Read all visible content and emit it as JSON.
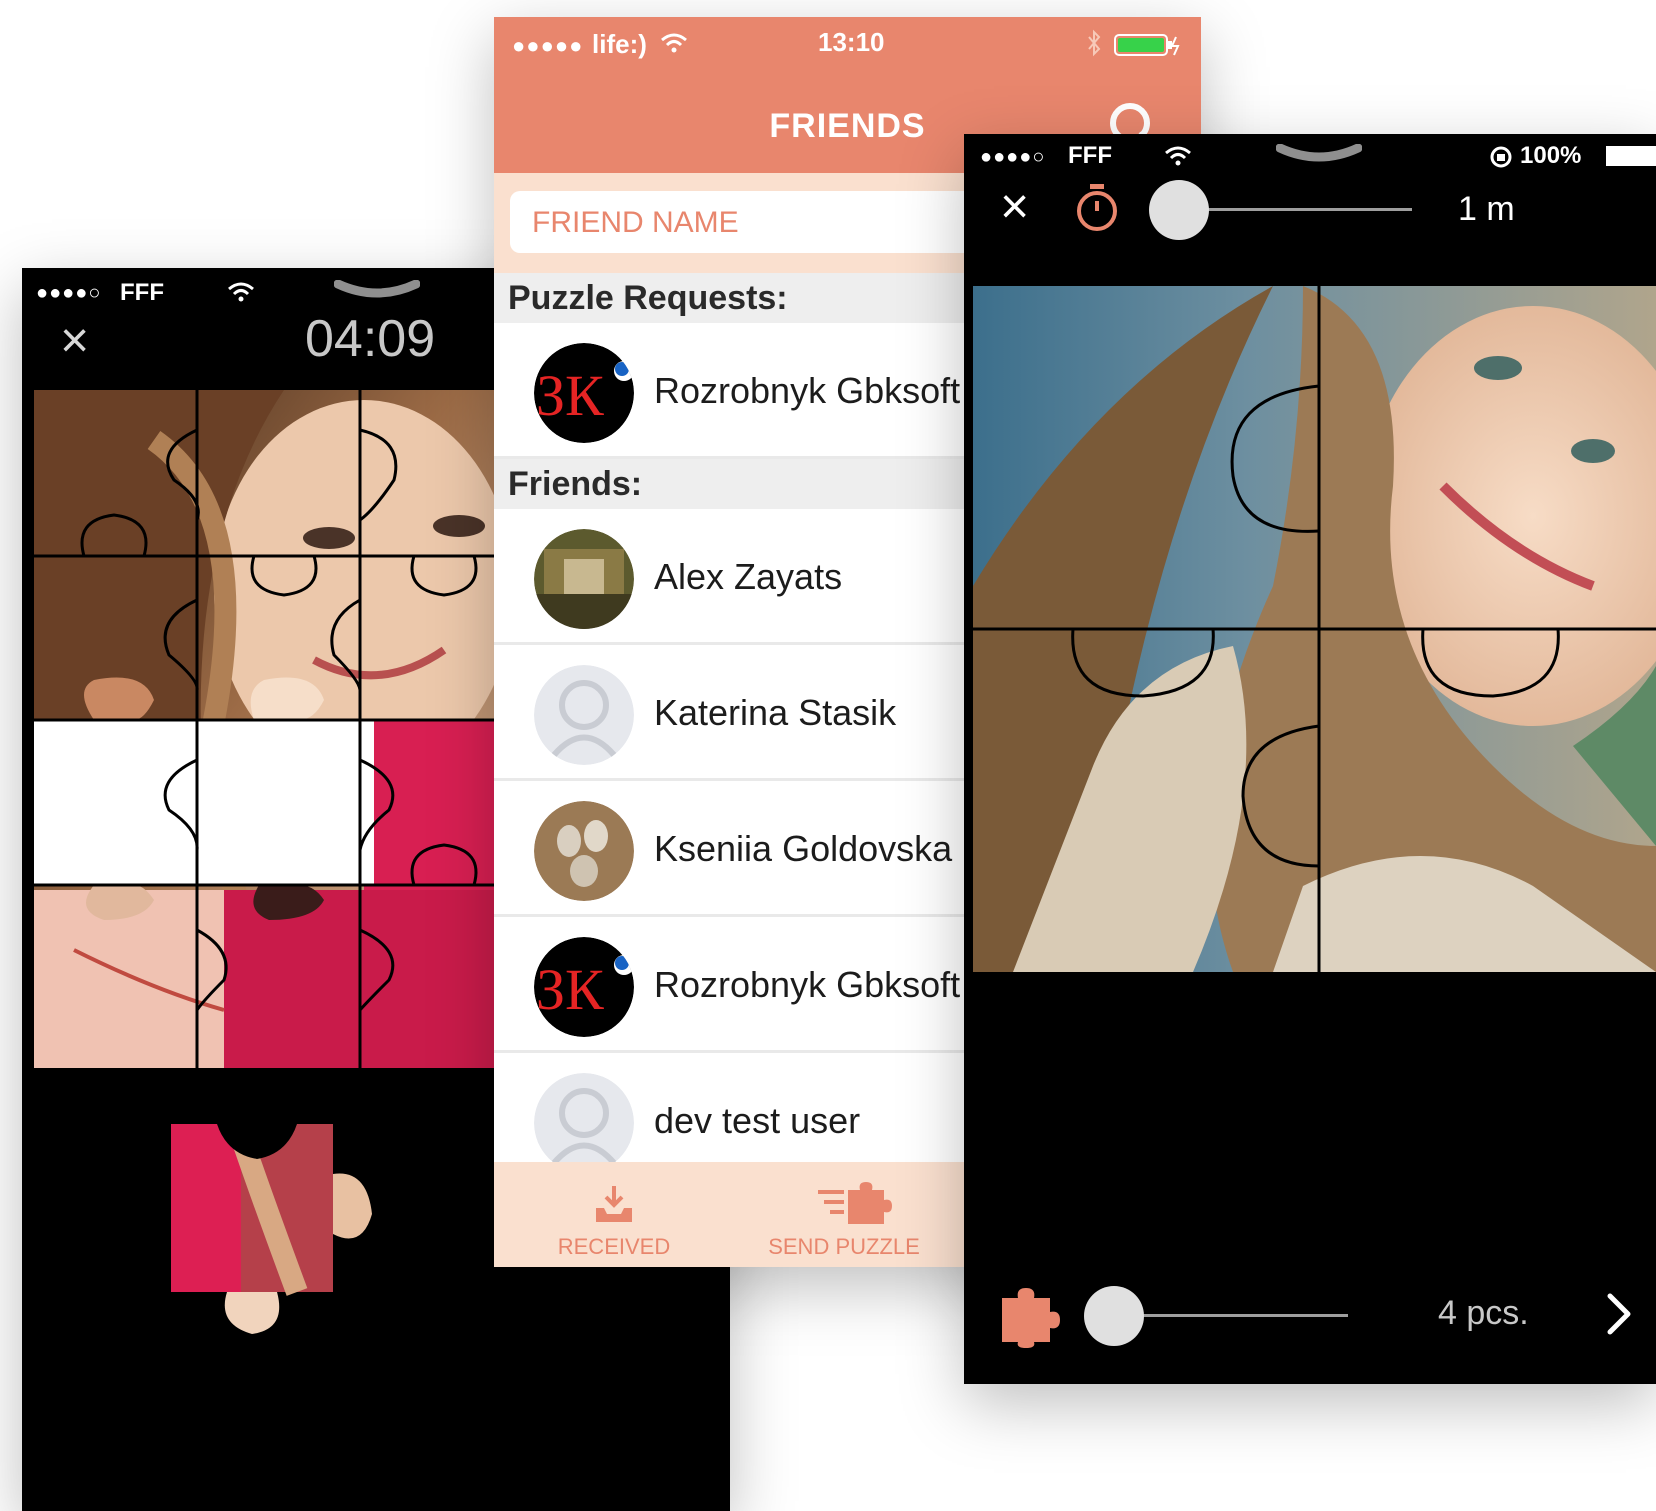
{
  "left_screen": {
    "status": {
      "signal_dots": "●●●●○",
      "carrier": "FFF"
    },
    "close_glyph": "×",
    "timer": "04:09"
  },
  "middle_screen": {
    "status": {
      "signal_dots": "●●●●●",
      "carrier": "life:)",
      "time": "13:10"
    },
    "title": "FRIENDS",
    "search": {
      "placeholder": "FRIEND NAME"
    },
    "requests_header": "Puzzle Requests:",
    "requests": [
      {
        "name": "Rozrobnyk Gbksoft"
      }
    ],
    "friends_header": "Friends:",
    "friends": [
      {
        "name": "Alex Zayats"
      },
      {
        "name": "Katerina Stasik"
      },
      {
        "name": "Kseniia Goldovska"
      },
      {
        "name": "Rozrobnyk Gbksoft"
      },
      {
        "name": "dev test user"
      }
    ],
    "tabs": [
      {
        "label": "RECEIVED"
      },
      {
        "label": "SEND PUZZLE"
      }
    ],
    "colors": {
      "accent": "#e8866d",
      "light": "#fae0cf"
    }
  },
  "right_screen": {
    "status": {
      "signal_dots": "●●●●○",
      "carrier": "FFF",
      "battery": "100%"
    },
    "close_glyph": "×",
    "time_value": "1 m",
    "pieces_value": "4 pcs."
  }
}
